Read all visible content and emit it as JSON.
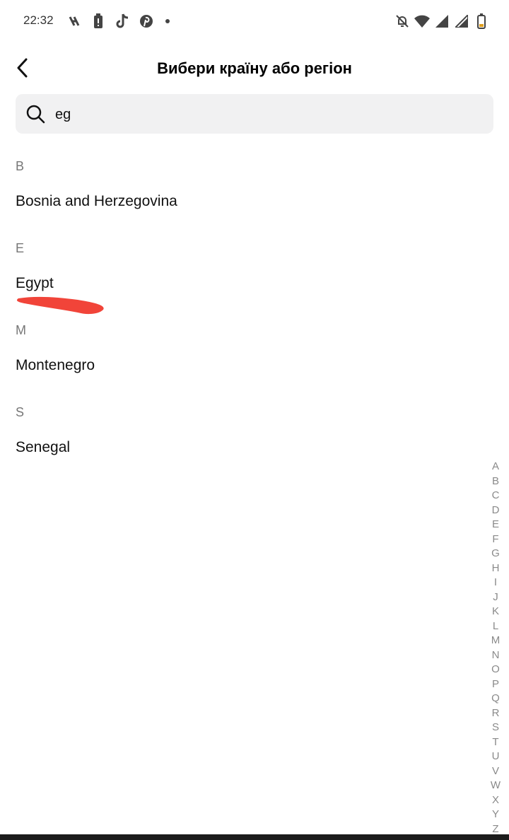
{
  "status_bar": {
    "time": "22:32",
    "left_icons": [
      "app-notification-icon",
      "battery-alert-icon",
      "tiktok-icon",
      "pinterest-icon",
      "more-dot-icon"
    ],
    "right_icons": [
      "bell-off-icon",
      "wifi-icon",
      "signal-icon",
      "signal-icon-2",
      "battery-low-icon"
    ]
  },
  "header": {
    "title": "Вибери країну або регіон",
    "back_icon": "chevron-left-icon"
  },
  "search": {
    "value": "eg",
    "icon": "search-icon"
  },
  "sections": [
    {
      "letter": "B",
      "countries": [
        "Bosnia and Herzegovina"
      ]
    },
    {
      "letter": "E",
      "countries": [
        "Egypt"
      ]
    },
    {
      "letter": "M",
      "countries": [
        "Montenegro"
      ]
    },
    {
      "letter": "S",
      "countries": [
        "Senegal"
      ]
    }
  ],
  "alphabet_index": [
    "A",
    "B",
    "C",
    "D",
    "E",
    "F",
    "G",
    "H",
    "I",
    "J",
    "K",
    "L",
    "M",
    "N",
    "O",
    "P",
    "Q",
    "R",
    "S",
    "T",
    "U",
    "V",
    "W",
    "X",
    "Y",
    "Z"
  ],
  "colors": {
    "search_bg": "#f1f1f2",
    "section_letter": "#777777",
    "index_letter": "#8a8a8a",
    "annotation_red": "#f03a2e"
  }
}
